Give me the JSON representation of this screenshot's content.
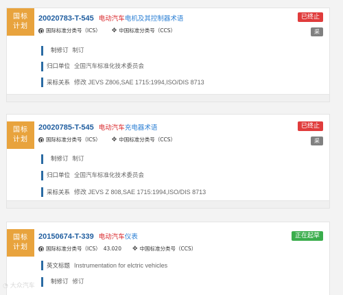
{
  "cards": [
    {
      "badge": [
        "国标",
        "计划"
      ],
      "std_no": "20020783-T-545",
      "title_red": "电动汽车",
      "title_rest": "电机及其控制器术语",
      "status": "已终止",
      "status_color": "#e03c3c",
      "cai": "采",
      "ics_label": "国际标准分类号（ICS）",
      "ics_code": "",
      "ccs_label": "中国标准分类号（CCS）",
      "fields": [
        {
          "label": "制修订",
          "value": "制订"
        },
        {
          "label": "归口单位",
          "value": "全国汽车标准化技术委员会"
        },
        {
          "label": "采标关系",
          "value": "修改  JEVS Z806,SAE 1715:1994,ISO/DIS 8713"
        }
      ]
    },
    {
      "badge": [
        "国标",
        "计划"
      ],
      "std_no": "20020785-T-545",
      "title_red": "电动汽车",
      "title_rest": "充电器术语",
      "status": "已终止",
      "status_color": "#e03c3c",
      "cai": "采",
      "ics_label": "国际标准分类号（ICS）",
      "ics_code": "",
      "ccs_label": "中国标准分类号（CCS）",
      "fields": [
        {
          "label": "制修订",
          "value": "制订"
        },
        {
          "label": "归口单位",
          "value": "全国汽车标准化技术委员会"
        },
        {
          "label": "采标关系",
          "value": "修改  JEVS Z 808,SAE 1715:1994,ISO/DIS 8713"
        }
      ]
    },
    {
      "badge": [
        "国标",
        "计划"
      ],
      "std_no": "20150674-T-339",
      "title_red": "电动汽车",
      "title_rest": "仪表",
      "status": "正在起草",
      "status_color": "#3aad4c",
      "cai": "",
      "ics_label": "国际标准分类号（ICS）",
      "ics_code": "43.020",
      "ccs_label": "中国标准分类号（CCS）",
      "fields": [
        {
          "label": "英文标题",
          "value": "Instrumentation for elctric vehicles"
        },
        {
          "label": "制修订",
          "value": "修订"
        }
      ]
    }
  ],
  "watermark": "大众汽车"
}
